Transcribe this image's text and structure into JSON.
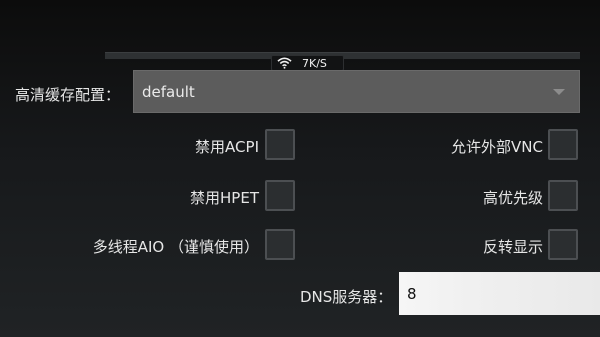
{
  "status": {
    "icon": "wifi-icon",
    "speed": "7K/S"
  },
  "cache": {
    "label": "高清缓存配置：",
    "value": "default"
  },
  "options": {
    "disable_acpi": {
      "label": "禁用ACPI",
      "checked": false
    },
    "allow_vnc": {
      "label": "允许外部VNC",
      "checked": false
    },
    "disable_hpet": {
      "label": "禁用HPET",
      "checked": false
    },
    "high_priority": {
      "label": "高优先级",
      "checked": false
    },
    "multithread_aio": {
      "label": "多线程AIO （谨慎使用）",
      "checked": false
    },
    "reverse_display": {
      "label": "反转显示",
      "checked": false
    }
  },
  "dns": {
    "label": "DNS服务器：",
    "value": "8"
  }
}
